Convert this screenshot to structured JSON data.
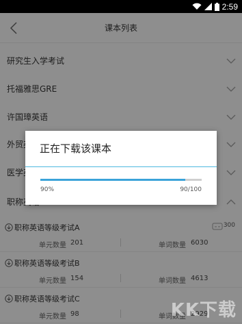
{
  "status_bar": {
    "time": "2:59"
  },
  "app_bar": {
    "title": "课本列表"
  },
  "categories": [
    {
      "label": "研究生入学考试"
    },
    {
      "label": "托福雅思GRE"
    },
    {
      "label": "许国璋英语"
    },
    {
      "label": "外贸英语"
    },
    {
      "label": "医学英语"
    },
    {
      "label": "职称英语"
    }
  ],
  "books": [
    {
      "title": "职称英语等级考试A",
      "unit_label": "单元数量",
      "units": "201",
      "word_label": "单词数量",
      "words": "6030",
      "count": "300"
    },
    {
      "title": "职称英语等级考试B",
      "unit_label": "单元数量",
      "units": "154",
      "word_label": "单词数量",
      "words": "4613"
    },
    {
      "title": "职称英语等级考试C",
      "unit_label": "单元数量",
      "units": "98",
      "word_label": "单词数量",
      "words": "2929"
    }
  ],
  "dialog": {
    "title": "正在下载该课本",
    "progress_fraction": 0.9,
    "percent_label": "90%",
    "fraction_label": "90/100"
  },
  "watermark": "KK下载",
  "colors": {
    "accent": "#3ba3d9",
    "divider_accent": "#4db8df"
  }
}
